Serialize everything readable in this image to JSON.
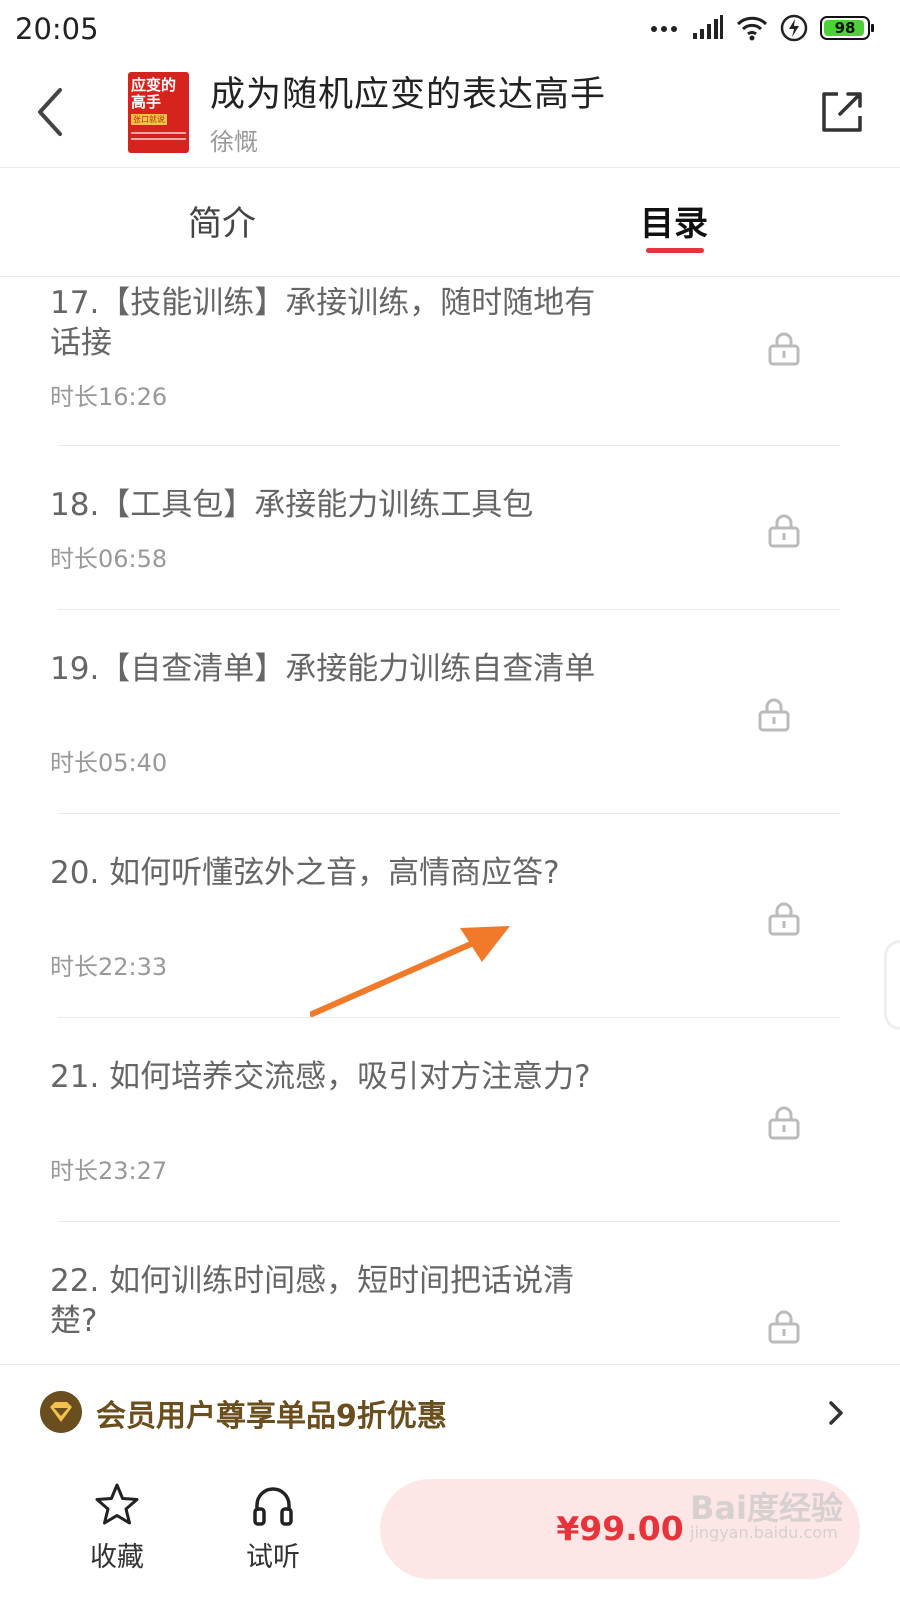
{
  "status_bar": {
    "time": "20:05",
    "battery": "98"
  },
  "header": {
    "title": "成为随机应变的表达高手",
    "author": "徐慨",
    "cover_title_line1": "应变的",
    "cover_title_line2": "高手",
    "cover_tag": "张口就说"
  },
  "tabs": [
    {
      "label": "简介",
      "active": false
    },
    {
      "label": "目录",
      "active": true
    }
  ],
  "episodes": [
    {
      "title": "17.【技能训练】承接训练，随时随地有话接",
      "duration": "时长16:26",
      "locked": true
    },
    {
      "title": "18.【工具包】承接能力训练工具包",
      "duration": "时长06:58",
      "locked": true
    },
    {
      "title": "19.【自查清单】承接能力训练自查清单",
      "duration": "时长05:40",
      "locked": true
    },
    {
      "title": "20. 如何听懂弦外之音，高情商应答?",
      "duration": "时长22:33",
      "locked": true
    },
    {
      "title": "21. 如何培养交流感，吸引对方注意力?",
      "duration": "时长23:27",
      "locked": true
    },
    {
      "title": "22. 如何训练时间感，短时间把话说清楚?",
      "duration": "",
      "locked": true
    }
  ],
  "member_banner": {
    "text": "会员用户尊享单品9折优惠"
  },
  "bottom_bar": {
    "favorite_label": "收藏",
    "listen_label": "试听",
    "price": "¥99.00"
  },
  "watermark": {
    "text": "Bai度经验",
    "sub": "jingyan.baidu.com"
  },
  "colors": {
    "accent": "#e8333a",
    "member_gold": "#6b4e1e",
    "price_bg": "#fde6e6",
    "annotation": "#f07a2a"
  },
  "icons": [
    "back-icon",
    "share-icon",
    "lock-icon",
    "vip-icon",
    "chevron-right-icon",
    "star-icon",
    "headphones-icon",
    "signal-icon",
    "wifi-icon",
    "charging-icon"
  ]
}
